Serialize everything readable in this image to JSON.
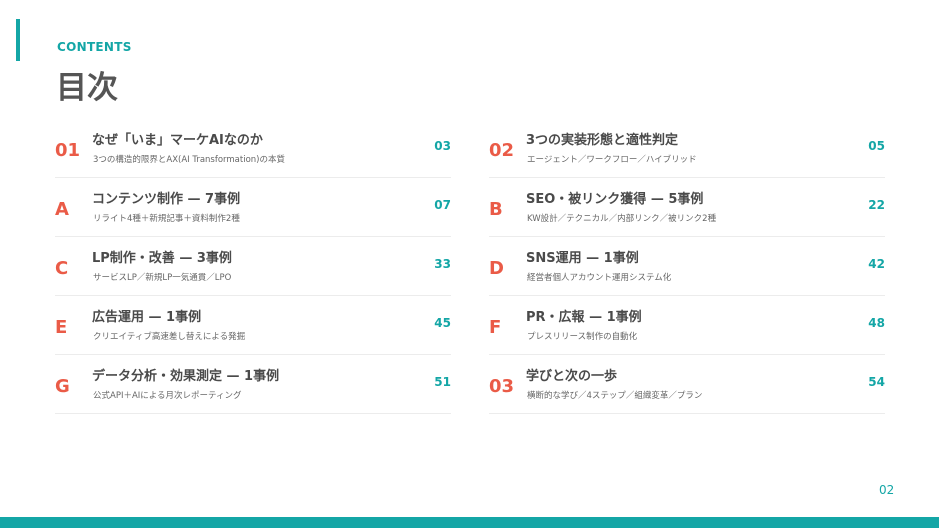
{
  "header": {
    "kicker": "CONTENTS",
    "title": "目次"
  },
  "left": [
    {
      "code": "01",
      "title": "なぜ「いま」マーケAIなのか",
      "subtitle": "3つの構造的限界とAX(AI Transformation)の本質",
      "page": "03"
    },
    {
      "code": "A",
      "title": "コンテンツ制作 — 7事例",
      "subtitle": "リライト4種＋新規記事＋資料制作2種",
      "page": "07"
    },
    {
      "code": "C",
      "title": "LP制作・改善 — 3事例",
      "subtitle": "サービスLP／新規LP一気通貫／LPO",
      "page": "33"
    },
    {
      "code": "E",
      "title": "広告運用 — 1事例",
      "subtitle": "クリエイティブ高速差し替えによる発掘",
      "page": "45"
    },
    {
      "code": "G",
      "title": "データ分析・効果測定 — 1事例",
      "subtitle": "公式API＋AIによる月次レポーティング",
      "page": "51"
    }
  ],
  "right": [
    {
      "code": "02",
      "title": "3つの実装形態と適性判定",
      "subtitle": "エージェント／ワークフロー／ハイブリッド",
      "page": "05"
    },
    {
      "code": "B",
      "title": "SEO・被リンク獲得 — 5事例",
      "subtitle": "KW設計／テクニカル／内部リンク／被リンク2種",
      "page": "22"
    },
    {
      "code": "D",
      "title": "SNS運用 — 1事例",
      "subtitle": "経営者個人アカウント運用システム化",
      "page": "42"
    },
    {
      "code": "F",
      "title": "PR・広報 — 1事例",
      "subtitle": "プレスリリース制作の自動化",
      "page": "48"
    },
    {
      "code": "03",
      "title": "学びと次の一歩",
      "subtitle": "横断的な学び／4ステップ／組織変革／プラン",
      "page": "54"
    }
  ],
  "footer": {
    "page_number": "02"
  },
  "colors": {
    "accent": "#14a6a6",
    "code": "#ea5b47"
  }
}
